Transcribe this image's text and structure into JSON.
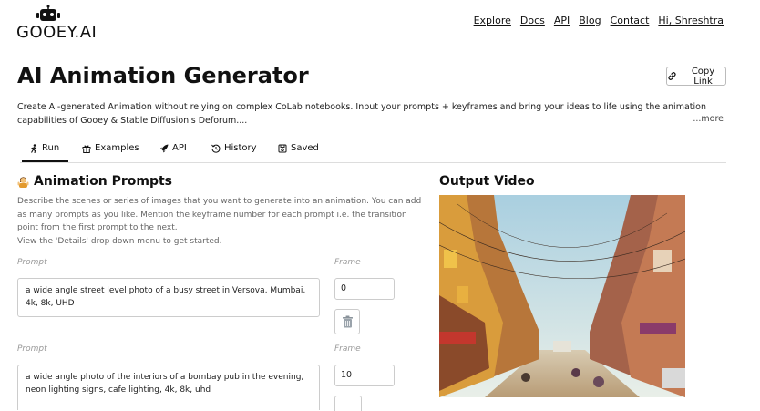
{
  "brand": {
    "name": "GOOEY.AI",
    "logo_icon": "robot-icon"
  },
  "nav": {
    "links": [
      "Explore",
      "Docs",
      "API",
      "Blog",
      "Contact",
      "Hi, Shreshtra"
    ]
  },
  "page": {
    "title": "AI Animation Generator",
    "copy_link_label": "Copy Link",
    "description": "Create AI-generated Animation without relying on complex CoLab notebooks. Input your prompts + keyframes and bring your ideas to life using the animation capabilities of Gooey & Stable Diffusion's Deforum....",
    "more_label": "...more"
  },
  "tabs": [
    {
      "label": "Run",
      "icon": "run-icon",
      "active": true
    },
    {
      "label": "Examples",
      "icon": "gift-icon",
      "active": false
    },
    {
      "label": "API",
      "icon": "rocket-icon",
      "active": false
    },
    {
      "label": "History",
      "icon": "history-icon",
      "active": false
    },
    {
      "label": "Saved",
      "icon": "saved-icon",
      "active": false
    }
  ],
  "prompts_section": {
    "title": "Animation Prompts",
    "icon": "person-gesturing-icon",
    "help_lines": [
      "Describe the scenes or series of images that you want to generate into an animation. You can add",
      "as many prompts as you like. Mention the keyframe number for each prompt i.e. the transition",
      "point from the first prompt to the next.",
      "View the 'Details' drop down menu to get started."
    ],
    "prompt_label": "Prompt",
    "frame_label": "Frame",
    "rows": [
      {
        "prompt": "a wide angle street level photo of a busy street in Versova, Mumbai, 4k, 8k, UHD",
        "frame": "0"
      },
      {
        "prompt": "a wide angle photo of the interiors of a bombay pub in the evening, neon lighting signs, cafe lighting, 4k, 8k, uhd",
        "frame": "10"
      }
    ]
  },
  "output": {
    "title": "Output Video"
  },
  "colors": {
    "text": "#111111",
    "muted": "#999999",
    "border": "#cccccc",
    "sky": "#cfe2ea",
    "building_warm": "#c98a3c"
  }
}
